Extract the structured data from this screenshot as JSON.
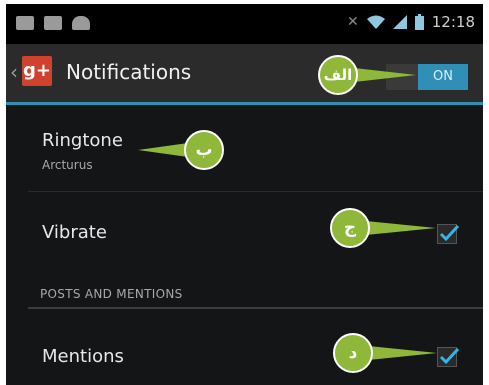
{
  "status_bar": {
    "time": "12:18",
    "left_icons": [
      "mail-icon",
      "photo-icon",
      "android-icon"
    ],
    "right_icons": [
      "mute-icon",
      "wifi-icon",
      "signal-icon",
      "battery-icon"
    ]
  },
  "action_bar": {
    "title": "Notifications",
    "app_icon_label": "g+",
    "toggle_label": "ON",
    "accent_color": "#2f8fb7"
  },
  "settings": {
    "ringtone": {
      "title": "Ringtone",
      "value": "Arcturus"
    },
    "vibrate": {
      "title": "Vibrate",
      "checked": true
    },
    "section_header": "POSTS AND MENTIONS",
    "mentions": {
      "title": "Mentions",
      "checked": true
    }
  },
  "callouts": {
    "a": "الف",
    "b": "ب",
    "c": "ج",
    "d": "د",
    "color": "#8fb73a"
  }
}
